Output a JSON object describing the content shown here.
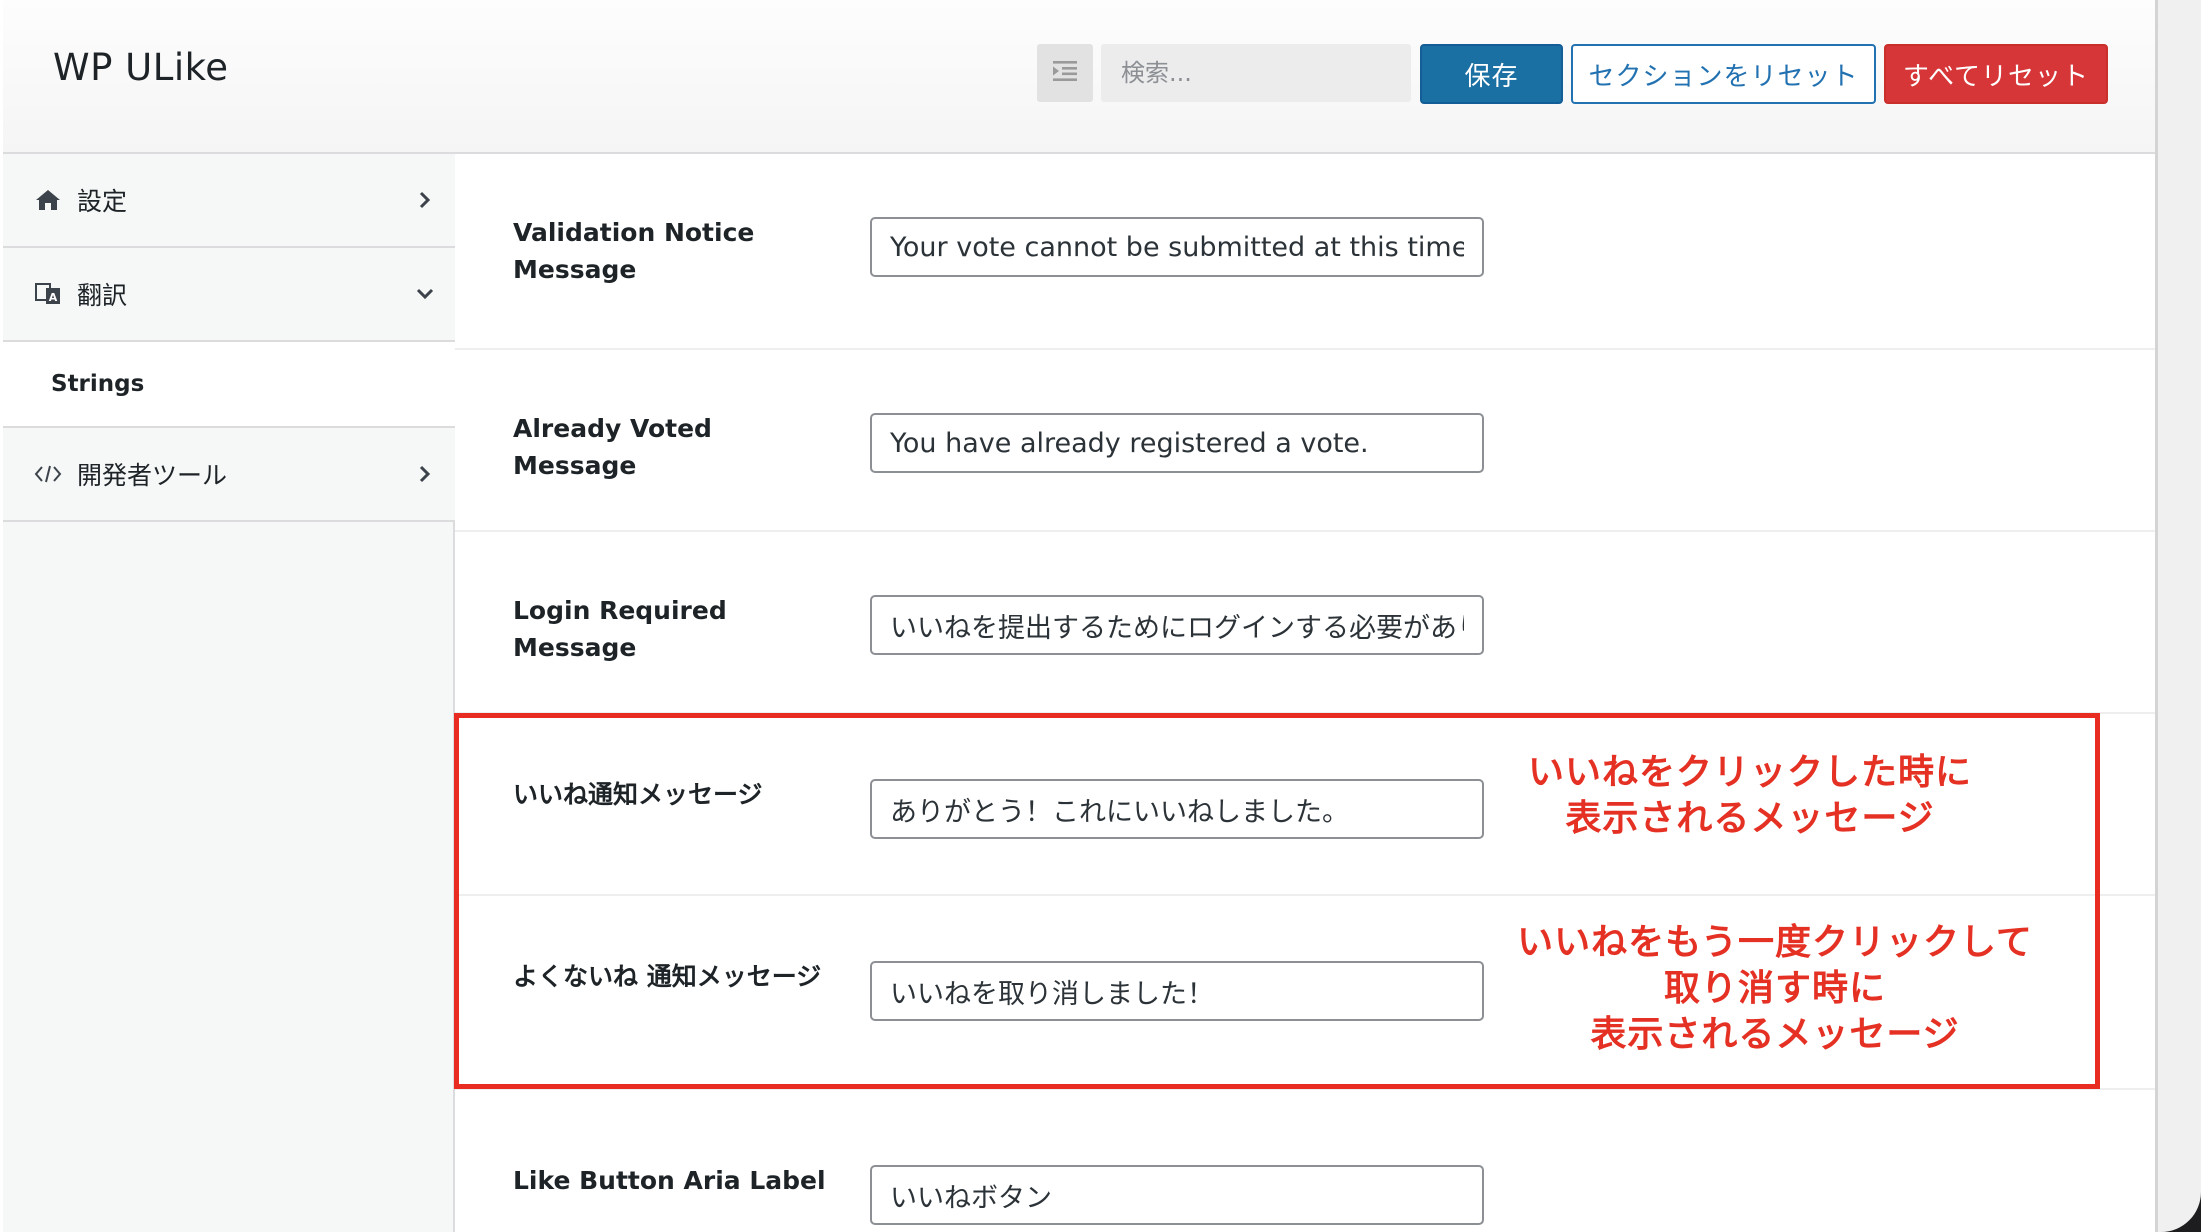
{
  "header": {
    "title": "WP ULike",
    "search_placeholder": "検索...",
    "save_label": "保存",
    "reset_section_label": "セクションをリセット",
    "reset_all_label": "すべてリセット"
  },
  "sidebar": {
    "items": [
      {
        "label": "設定",
        "icon": "home-icon",
        "chevron": "chevron-right-icon"
      },
      {
        "label": "翻訳",
        "icon": "translate-icon",
        "chevron": "chevron-down-icon"
      },
      {
        "label": "開発者ツール",
        "icon": "code-icon",
        "chevron": "chevron-right-icon"
      }
    ],
    "sub_items": [
      {
        "label": "Strings",
        "active": true
      }
    ]
  },
  "fields": [
    {
      "label": "Validation Notice Message",
      "value": "Your vote cannot be submitted at this time."
    },
    {
      "label": "Already Voted Message",
      "value": "You have already registered a vote."
    },
    {
      "label": "Login Required Message",
      "value": "いいねを提出するためにログインする必要があります。"
    },
    {
      "label": "いいね通知メッセージ",
      "value": "ありがとう！これにいいねしました。"
    },
    {
      "label": "よくないね 通知メッセージ",
      "value": "いいねを取り消しました！"
    },
    {
      "label": "Like Button Aria Label",
      "value": "いいねボタン"
    }
  ],
  "annotations": {
    "like_note": "いいねをクリックした時に\n表示されるメッセージ",
    "unlike_note": "いいねをもう一度クリックして\n取り消す時に\n表示されるメッセージ"
  },
  "colors": {
    "primary": "#1a6fa3",
    "danger": "#d63638",
    "annotation": "#e53124"
  }
}
